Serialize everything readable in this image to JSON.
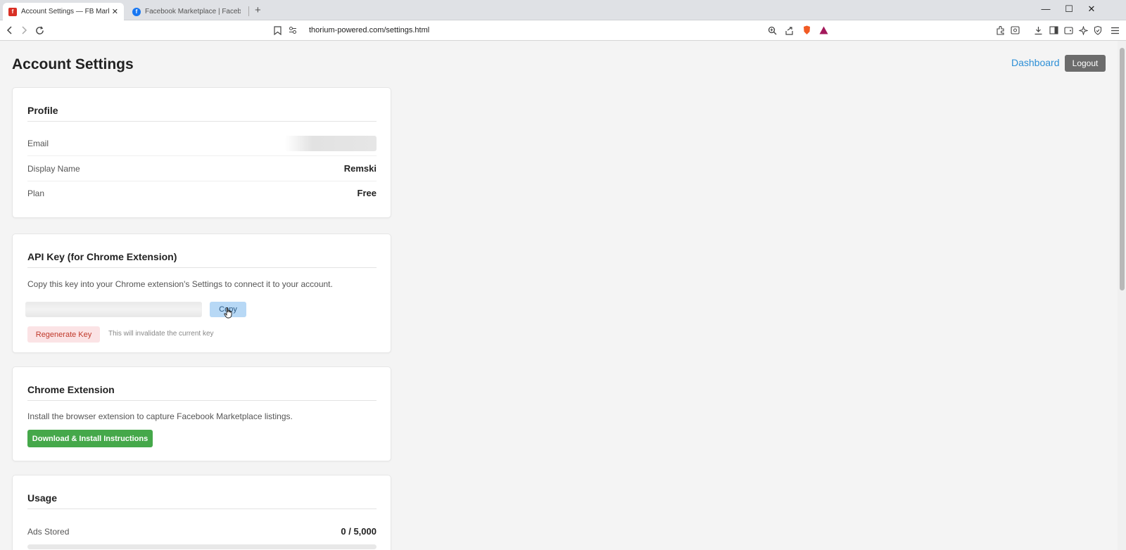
{
  "browser": {
    "tabs": [
      {
        "title": "Account Settings — FB Marketpl",
        "active": true,
        "close": "✕"
      },
      {
        "title": "Facebook Marketplace | Facebook",
        "active": false
      }
    ],
    "new_tab": "+",
    "url": "thorium-powered.com/settings.html",
    "window_controls": {
      "minimize": "—",
      "maximize": "☐",
      "close": "✕"
    }
  },
  "header": {
    "title": "Account Settings",
    "nav_link": "Dashboard",
    "logout_label": "Logout"
  },
  "profile": {
    "title": "Profile",
    "rows": [
      {
        "label": "Email",
        "value": ""
      },
      {
        "label": "Display Name",
        "value": "Remski"
      },
      {
        "label": "Plan",
        "value": "Free"
      }
    ]
  },
  "api_key": {
    "title": "API Key (for Chrome Extension)",
    "description": "Copy this key into your Chrome extension's Settings to connect it to your account.",
    "copy_label": "Copy",
    "regenerate_label": "Regenerate Key",
    "regenerate_note": "This will invalidate the current key"
  },
  "extension": {
    "title": "Chrome Extension",
    "description": "Install the browser extension to capture Facebook Marketplace listings.",
    "button_label": "Download & Install Instructions"
  },
  "usage": {
    "title": "Usage",
    "ads_label": "Ads Stored",
    "ads_value": "0 / 5,000",
    "progress_fraction": 0
  },
  "colors": {
    "accent_link": "#2d8fd6",
    "success": "#45a84a",
    "danger": "#c0392b"
  }
}
